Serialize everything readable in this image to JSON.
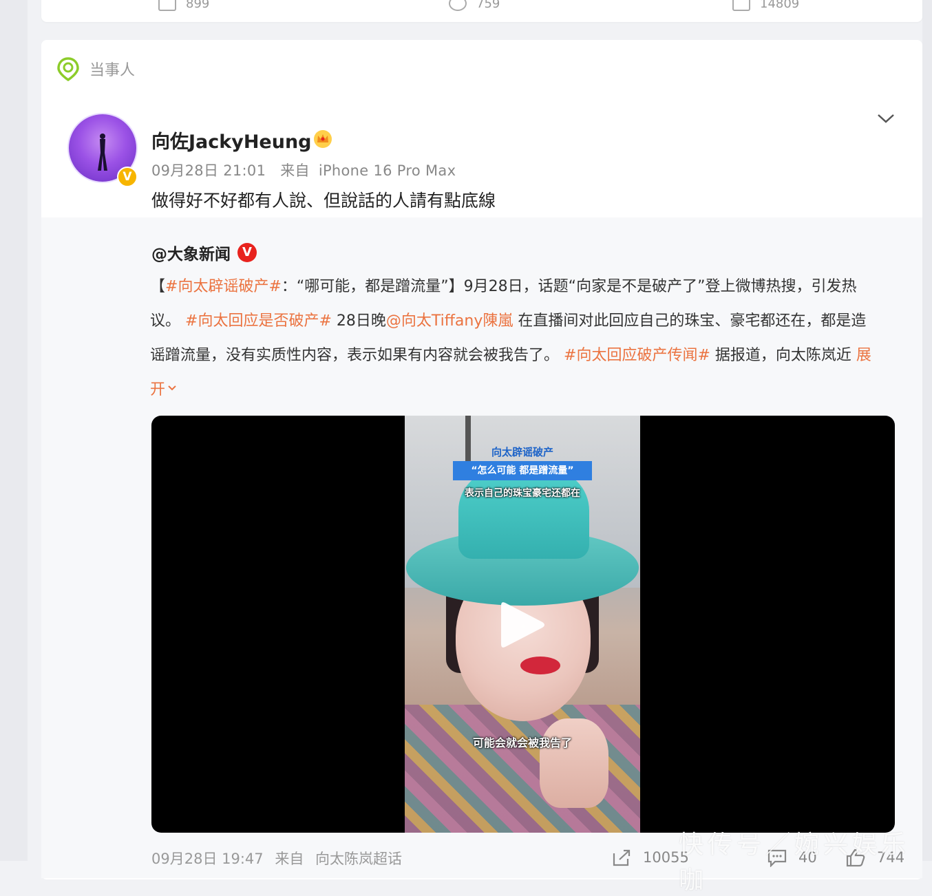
{
  "prev_card": {
    "actions": [
      {
        "icon": "share-icon",
        "count": "899"
      },
      {
        "icon": "comment-icon",
        "count": "759"
      },
      {
        "icon": "like-icon",
        "count": "14809"
      }
    ]
  },
  "card": {
    "tag": {
      "icon": "location-pin-icon",
      "label": "当事人"
    },
    "author": {
      "name": "向佐JackyHeung",
      "badge": "V",
      "date": "09月28日 21:01",
      "source_prefix": "来自",
      "source_device": "iPhone 16 Pro Max"
    },
    "post_text": "做得好不好都有人說、但說話的人請有點底線",
    "repost": {
      "source_name": "@大象新闻",
      "source_badge": "V",
      "body": {
        "p1": "【",
        "tag1": "#向太辟谣破产#",
        "p2": "：“哪可能，都是蹭流量”】9月28日，话题“向家是不是破产了”登上微博热搜，引发热议。",
        "tag2": "#向太回应是否破产#",
        "p3": " 28日晚",
        "mention": "@向太Tiffany陳嵐",
        "p4": " 在直播间对此回应自己的珠宝、豪宅都还在，都是造谣蹭流量，没有实质性内容，表示如果有内容就会被我告了。",
        "tag3": "#向太回应破产传闻#",
        "p5": " 据报道，向太陈岚近",
        "expand": "展开"
      },
      "video": {
        "caption_top": "向太辟谣破产",
        "caption_box": "“怎么可能 都是蹭流量”",
        "caption_line3": "表示自己的珠宝豪宅还都在",
        "caption_bottom": "可能会就会被我告了"
      },
      "footer": {
        "date": "09月28日 19:47",
        "source_prefix": "来自",
        "source": "向太陈岚超话",
        "share_count": "10055",
        "comment_count": "40",
        "like_count": "744"
      }
    }
  },
  "watermark": "快传号／婉兴娱乐咖",
  "colors": {
    "accent_orange": "#eb7340",
    "verify_gold": "#f7b500",
    "verify_red": "#e8231e"
  }
}
